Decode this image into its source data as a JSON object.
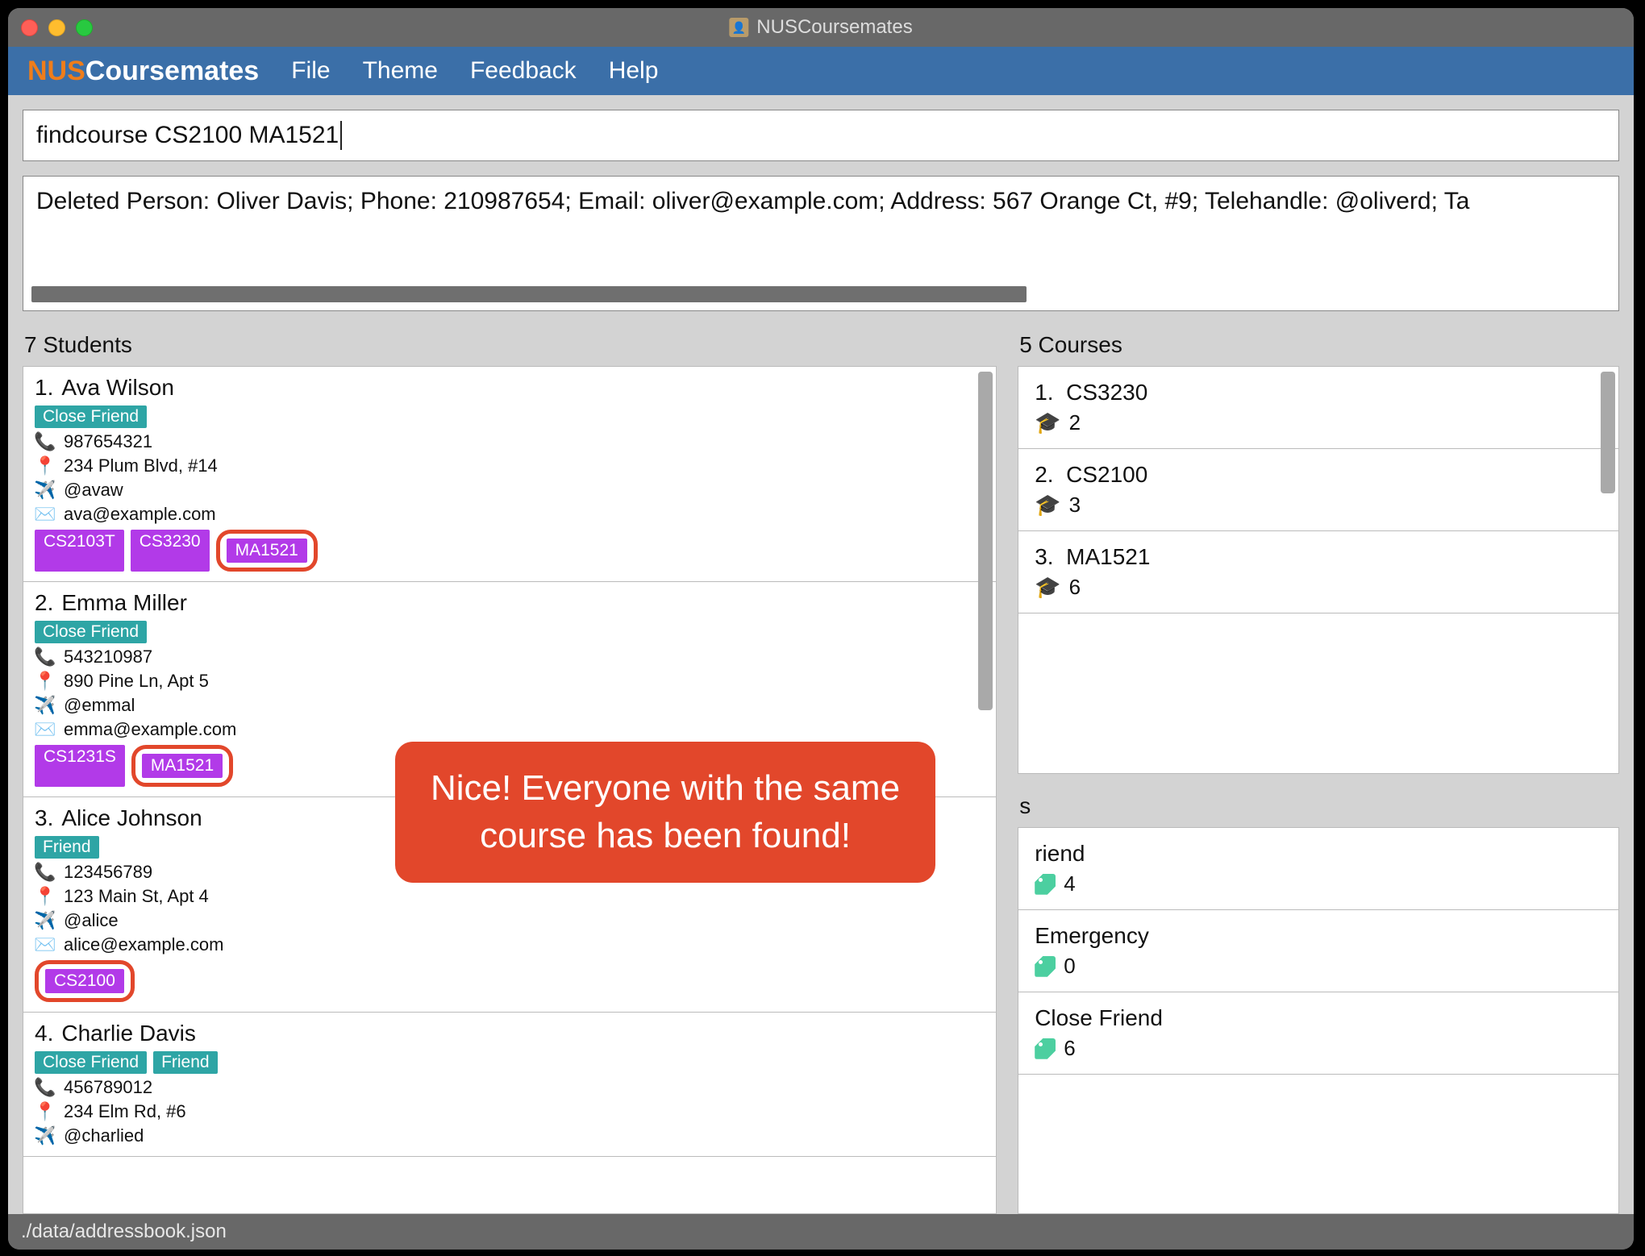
{
  "window": {
    "title": "NUSCoursemates"
  },
  "brand": {
    "nus": "NUS",
    "rest": "Coursemates"
  },
  "menu": {
    "file": "File",
    "theme": "Theme",
    "feedback": "Feedback",
    "help": "Help"
  },
  "command": "findcourse CS2100 MA1521",
  "result": "Deleted Person: Oliver Davis; Phone: 210987654; Email: oliver@example.com; Address: 567 Orange Ct, #9; Telehandle: @oliverd; Ta",
  "students_header": "7 Students",
  "courses_header": "5 Courses",
  "tags_header": "s",
  "students": [
    {
      "idx": "1.",
      "name": "Ava Wilson",
      "tags": [
        "Close Friend"
      ],
      "phone": "987654321",
      "address": "234 Plum Blvd, #14",
      "tele": "@avaw",
      "email": "ava@example.com",
      "courses": [
        {
          "code": "CS2103T",
          "hl": false
        },
        {
          "code": "CS3230",
          "hl": false
        },
        {
          "code": "MA1521",
          "hl": true
        }
      ]
    },
    {
      "idx": "2.",
      "name": "Emma Miller",
      "tags": [
        "Close Friend"
      ],
      "phone": "543210987",
      "address": "890 Pine Ln, Apt 5",
      "tele": "@emmal",
      "email": "emma@example.com",
      "courses": [
        {
          "code": "CS1231S",
          "hl": false
        },
        {
          "code": "MA1521",
          "hl": true
        }
      ]
    },
    {
      "idx": "3.",
      "name": "Alice Johnson",
      "tags": [
        "Friend"
      ],
      "phone": "123456789",
      "address": "123 Main St, Apt 4",
      "tele": "@alice",
      "email": "alice@example.com",
      "courses": [
        {
          "code": "CS2100",
          "hl": true
        }
      ],
      "email_obscured": true
    },
    {
      "idx": "4.",
      "name": "Charlie Davis",
      "tags": [
        "Close Friend",
        "Friend"
      ],
      "phone": "456789012",
      "address": "234 Elm Rd, #6",
      "tele": "@charlied",
      "email": "",
      "courses": []
    }
  ],
  "courses": [
    {
      "idx": "1.",
      "code": "CS3230",
      "count": "2"
    },
    {
      "idx": "2.",
      "code": "CS2100",
      "count": "3"
    },
    {
      "idx": "3.",
      "code": "MA1521",
      "count": "6"
    }
  ],
  "taglist": [
    {
      "label": "riend",
      "count": "4"
    },
    {
      "label": "Emergency",
      "count": "0"
    },
    {
      "label": "Close Friend",
      "count": "6"
    }
  ],
  "statusbar": "./data/addressbook.json",
  "callout": {
    "l1": "Nice! Everyone with the same",
    "l2": "course has been found!"
  }
}
